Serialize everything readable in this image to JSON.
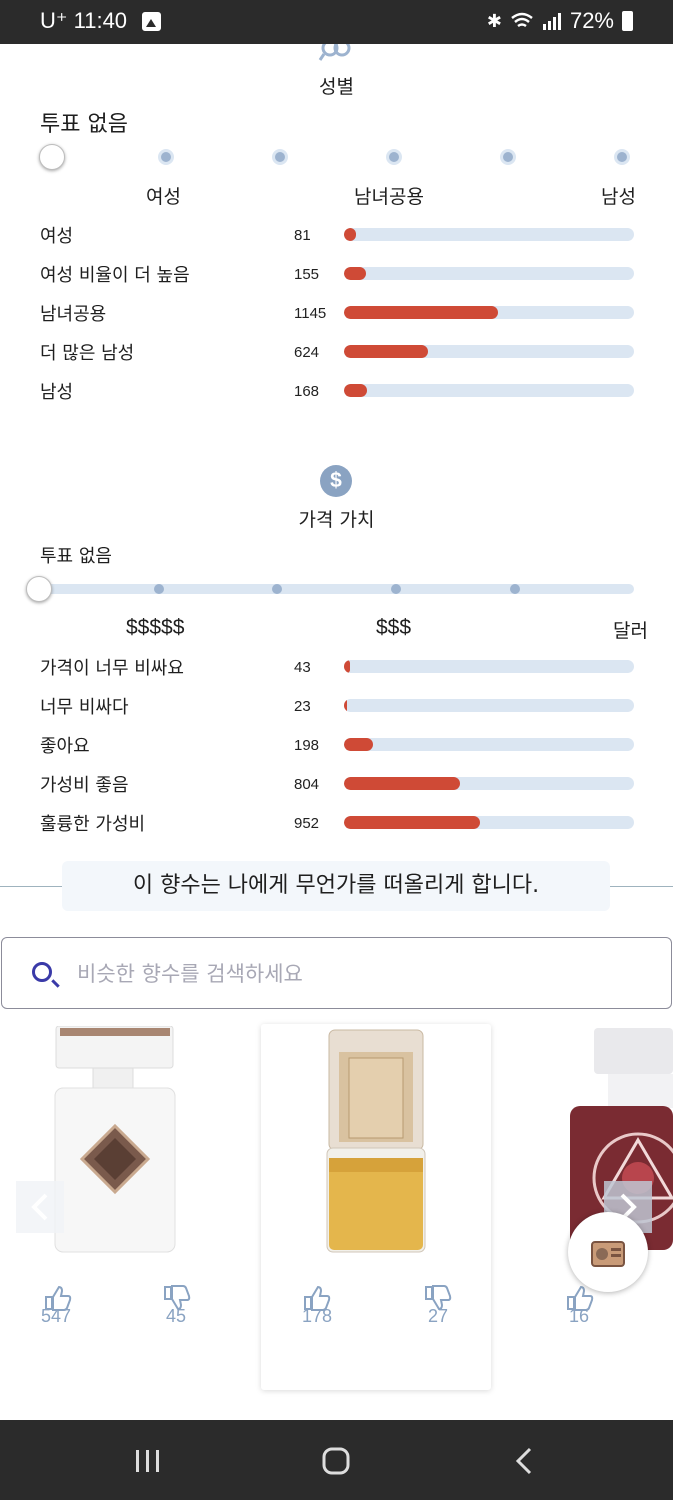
{
  "status_bar": {
    "carrier_time": "U⁺ 11:40",
    "battery": "72%"
  },
  "gender": {
    "title": "성별",
    "vote_none": "투표 없음",
    "scale_labels": [
      "여성",
      "남녀공용",
      "남성"
    ],
    "rows": [
      {
        "label": "여성",
        "count": "81",
        "fraction": 0.04
      },
      {
        "label": "여성 비율이 더 높음",
        "count": "155",
        "fraction": 0.075
      },
      {
        "label": "남녀공용",
        "count": "1145",
        "fraction": 0.53
      },
      {
        "label": "더 많은 남성",
        "count": "624",
        "fraction": 0.29
      },
      {
        "label": "남성",
        "count": "168",
        "fraction": 0.08
      }
    ]
  },
  "price": {
    "title": "가격 가치",
    "icon": "dollar-icon",
    "vote_none": "투표 없음",
    "scale_labels": [
      "$$$$$",
      "$$$",
      "달러"
    ],
    "rows": [
      {
        "label": "가격이 너무 비싸요",
        "count": "43",
        "fraction": 0.02
      },
      {
        "label": "너무 비싸다",
        "count": "23",
        "fraction": 0.008
      },
      {
        "label": "좋아요",
        "count": "198",
        "fraction": 0.1
      },
      {
        "label": "가성비 좋음",
        "count": "804",
        "fraction": 0.4
      },
      {
        "label": "훌륭한 가성비",
        "count": "952",
        "fraction": 0.47
      }
    ]
  },
  "reminds": {
    "heading": "이 향수는 나에게 무언가를 떠올리게 합니다.",
    "search_placeholder": "비슷한 향수를 검색하세요",
    "cards": [
      {
        "likes": "547",
        "dislikes": "45"
      },
      {
        "likes": "178",
        "dislikes": "27"
      },
      {
        "likes": "16"
      }
    ]
  },
  "colors": {
    "bar_fill": "#cf4a36",
    "bar_track": "#dbe6f2",
    "accent_icon": "#8aa3c2"
  }
}
